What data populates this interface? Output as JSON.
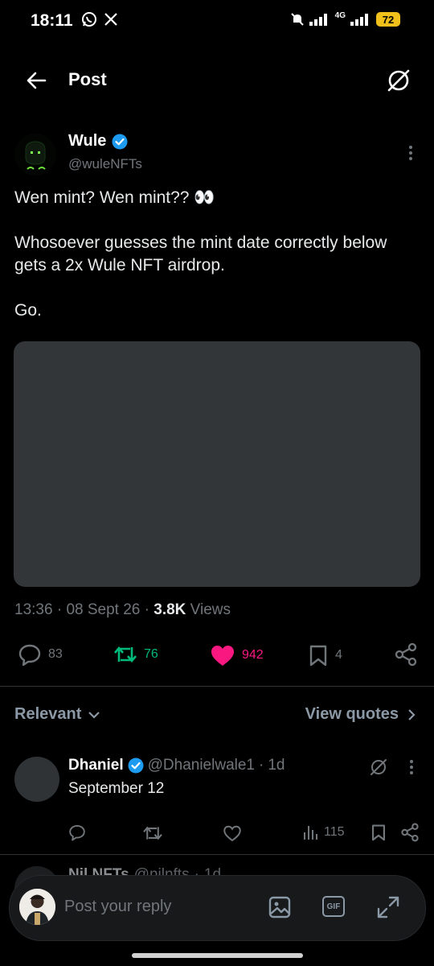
{
  "status_bar": {
    "time": "18:11",
    "network": "4G",
    "battery": "72"
  },
  "header": {
    "title": "Post"
  },
  "post": {
    "author_name": "Wule",
    "author_handle": "@wuleNFTs",
    "text": "Wen mint? Wen mint?? 👀\n\nWhosoever guesses the mint date correctly below gets a 2x Wule NFT airdrop.\n\nGo.",
    "time": "13:36",
    "date": "08 Sept 26",
    "views_count": "3.8K",
    "views_label": "Views",
    "separator": "·",
    "stats": {
      "replies": "83",
      "reposts": "76",
      "likes": "942",
      "bookmarks": "4"
    }
  },
  "sort": {
    "label": "Relevant",
    "view_quotes": "View quotes"
  },
  "replies": [
    {
      "name": "Dhaniel",
      "handle": "@Dhanielwale1",
      "age": "1d",
      "text": "September 12",
      "views": "115"
    },
    {
      "name": "Nil NFTs",
      "handle": "@nilnfts",
      "age": "1d"
    }
  ],
  "composer": {
    "placeholder": "Post your reply",
    "gif_label": "GIF"
  },
  "colors": {
    "background": "#000000",
    "accent_blue": "#1d9bf0",
    "repost_green": "#00ba7c",
    "like_pink": "#f91880",
    "muted": "#71767b",
    "battery": "#f2c01a"
  },
  "icons": [
    "whatsapp-icon",
    "x-logo-icon",
    "back-arrow-icon",
    "grok-icon",
    "verified-icon",
    "more-icon",
    "reply-icon",
    "repost-icon",
    "like-icon",
    "bookmark-icon",
    "share-icon",
    "chevron-down-icon",
    "chevron-right-icon",
    "views-icon",
    "image-icon",
    "gif-icon",
    "expand-icon"
  ]
}
